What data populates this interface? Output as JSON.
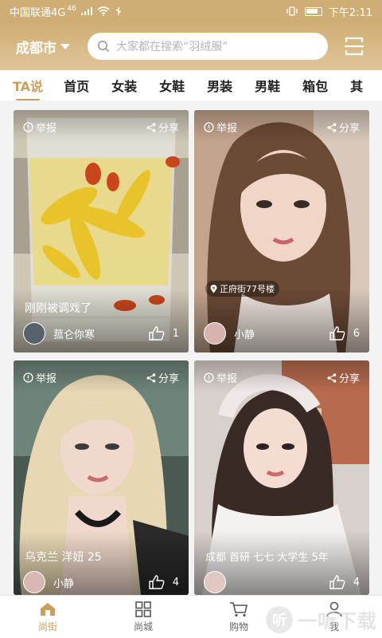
{
  "status_bar": {
    "carrier": "中国联通4G",
    "signal": "46",
    "time": "下午2:11"
  },
  "header": {
    "city": "成都市",
    "search_placeholder": "大家都在搜索“羽绒服”"
  },
  "tabs": [
    "TA说",
    "首页",
    "女装",
    "女鞋",
    "男装",
    "男鞋",
    "箱包",
    "其"
  ],
  "active_tab": 0,
  "cards": [
    {
      "report": "举报",
      "share": "分享",
      "caption": "刚刚被调戏了",
      "user": "菰仑你寒",
      "likes": "1",
      "theme": "flower-tea"
    },
    {
      "report": "举报",
      "share": "分享",
      "location": "正府街77号楼",
      "user": "小静",
      "likes": "6",
      "theme": "portrait-brown"
    },
    {
      "report": "举报",
      "share": "分享",
      "caption": "乌克兰 洋妞 25",
      "user": "小静",
      "likes": "4",
      "theme": "portrait-blonde"
    },
    {
      "report": "举报",
      "share": "分享",
      "caption": "成都 首研 七七 大学生 5年",
      "user": "",
      "likes": "4",
      "theme": "portrait-white"
    }
  ],
  "bottom_nav": [
    {
      "label": "尚街",
      "icon": "home-icon",
      "active": true
    },
    {
      "label": "尚城",
      "icon": "grid-icon",
      "active": false
    },
    {
      "label": "购物",
      "icon": "cart-icon",
      "active": false
    },
    {
      "label": "我",
      "icon": "person-icon",
      "active": false
    }
  ],
  "watermark": {
    "glyph": "听",
    "text": "一听下载"
  },
  "colors": {
    "accent": "#c99f5b",
    "header": "#cfad74"
  }
}
